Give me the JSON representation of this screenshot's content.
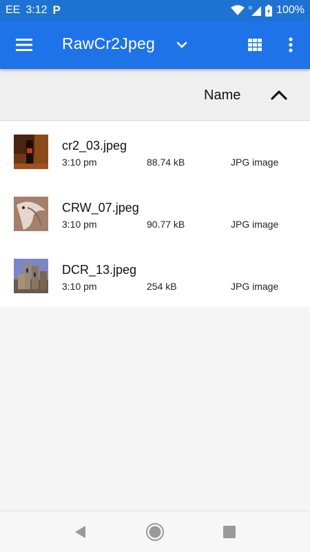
{
  "status_bar": {
    "carrier": "EE",
    "time": "3:12",
    "notification_letter": "P",
    "roaming": "R",
    "battery": "100%"
  },
  "app_bar": {
    "title": "RawCr2Jpeg",
    "icons": [
      "menu-icon",
      "chevron-down-icon",
      "grid-view-icon",
      "more-vert-icon"
    ],
    "color": "#1e73e8"
  },
  "sort": {
    "label": "Name",
    "direction_icon": "chevron-up-icon"
  },
  "files": [
    {
      "name": "cr2_03.jpeg",
      "time": "3:10 pm",
      "size": "88.74 kB",
      "type": "JPG image"
    },
    {
      "name": "CRW_07.jpeg",
      "time": "3:10 pm",
      "size": "90.77 kB",
      "type": "JPG image"
    },
    {
      "name": "DCR_13.jpeg",
      "time": "3:10 pm",
      "size": "254 kB",
      "type": "JPG image"
    }
  ],
  "nav_bar": {
    "icons": [
      "back-icon",
      "home-icon",
      "recent-apps-icon"
    ]
  }
}
